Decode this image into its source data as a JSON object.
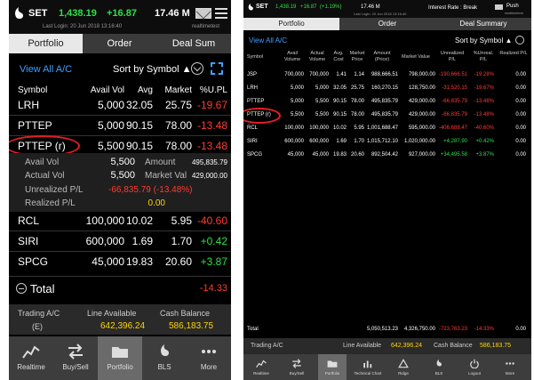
{
  "left": {
    "header": {
      "index": "SET",
      "price": "1,438.19",
      "change": "+16.87",
      "time": "17.46 M",
      "login": "Last Login: 20 Jun 2018 13:16:40",
      "user": "realtimetest"
    },
    "tabs": [
      "Portfolio",
      "Order",
      "Deal Sum"
    ],
    "view_all": "View All A/C",
    "sort": "Sort by Symbol ▲",
    "columns": [
      "Symbol",
      "Avail Vol",
      "Avg",
      "Market",
      "%U.PL"
    ],
    "rows": [
      {
        "symbol": "LRH",
        "vol": "5,000",
        "avg": "32.05",
        "market": "25.75",
        "upl": "-19.67",
        "sign": "neg"
      },
      {
        "symbol": "PTTEP",
        "vol": "5,000",
        "avg": "90.15",
        "market": "78.00",
        "upl": "-13.48",
        "sign": "neg"
      },
      {
        "symbol": "PTTEP (r)",
        "vol": "5,500",
        "avg": "90.15",
        "market": "78.00",
        "upl": "-13.48",
        "sign": "neg"
      }
    ],
    "detail": {
      "avail_vol_label": "Avail Vol",
      "avail_vol": "5,500",
      "amount_label": "Amount",
      "amount": "495,835.79",
      "actual_vol_label": "Actual Vol",
      "actual_vol": "5,500",
      "market_val_label": "Market Val",
      "market_val": "429,000.00",
      "unrealized_label": "Unrealized P/L",
      "unrealized": "-66,835.79 (-13.48%)",
      "realized_label": "Realized P/L",
      "realized": "0.00"
    },
    "rows2": [
      {
        "symbol": "RCL",
        "vol": "100,000",
        "avg": "10.02",
        "market": "5.95",
        "upl": "-40.60",
        "sign": "neg"
      },
      {
        "symbol": "SIRI",
        "vol": "600,000",
        "avg": "1.69",
        "market": "1.70",
        "upl": "+0.42",
        "sign": "pos"
      },
      {
        "symbol": "SPCG",
        "vol": "45,000",
        "avg": "19.83",
        "market": "20.60",
        "upl": "+3.87",
        "sign": "pos"
      }
    ],
    "total_label": "Total",
    "total_value": "-14.33",
    "footer": {
      "trading_label": "Trading A/C",
      "trading_value": "(E)",
      "line_label": "Line Available",
      "line_value": "642,396.24",
      "cash_label": "Cash Balance",
      "cash_value": "586,183.75"
    },
    "nav": [
      "Realtime",
      "Buy/Sell",
      "Portfolio",
      "BLS",
      "More"
    ]
  },
  "right": {
    "header": {
      "index": "SET",
      "price": "1,438.19",
      "change": "+16.87",
      "pct": "(+1.19%)",
      "time": "17.46 M",
      "login": "Last Login: 20 Jun 2018 13:16:40",
      "interest": "Interest Rate : Break",
      "push": "Push",
      "user": "realtimetest"
    },
    "tabs": [
      "Portfolio",
      "Order",
      "Deal Summary"
    ],
    "view_all": "View All A/C",
    "sort": "Sort by Symbol ▲",
    "columns": [
      "Symbol",
      "Avail Volume",
      "Actual Volume",
      "Avg. Cost",
      "Market Price",
      "Amount (Price)",
      "Market Value",
      "Unrealized P/L",
      "%Unreal. P/L",
      "Realized P/L"
    ],
    "rows": [
      {
        "symbol": "JSP",
        "avail": "700,000",
        "actual": "700,000",
        "avg": "1.41",
        "mkt": "1.14",
        "amount": "988,666.51",
        "mval": "798,000.00",
        "upl": "-190,666.51",
        "pct": "-19.28%",
        "real": "0.00",
        "sign": "neg"
      },
      {
        "symbol": "LRH",
        "avail": "5,000",
        "actual": "5,000",
        "avg": "32.05",
        "mkt": "25.75",
        "amount": "160,270.15",
        "mval": "128,750.00",
        "upl": "-31,520.15",
        "pct": "-19.67%",
        "real": "0.00",
        "sign": "neg"
      },
      {
        "symbol": "PTTEP",
        "avail": "5,000",
        "actual": "5,500",
        "avg": "90.15",
        "mkt": "78.00",
        "amount": "495,835.79",
        "mval": "429,000.00",
        "upl": "-66,835.79",
        "pct": "-13.48%",
        "real": "0.00",
        "sign": "neg"
      },
      {
        "symbol": "PTTEP (r)",
        "avail": "5,500",
        "actual": "5,500",
        "avg": "90.15",
        "mkt": "78.00",
        "amount": "495,835.79",
        "mval": "429,000.00",
        "upl": "-66,835.79",
        "pct": "-13.48%",
        "real": "0.00",
        "sign": "neg"
      },
      {
        "symbol": "RCL",
        "avail": "100,000",
        "actual": "100,000",
        "avg": "10.02",
        "mkt": "5.95",
        "amount": "1,001,688.47",
        "mval": "595,000.00",
        "upl": "-406,688.47",
        "pct": "-40.60%",
        "real": "0.00",
        "sign": "neg"
      },
      {
        "symbol": "SIRI",
        "avail": "600,000",
        "actual": "600,000",
        "avg": "1.69",
        "mkt": "1.70",
        "amount": "1,015,712.10",
        "mval": "1,020,000.00",
        "upl": "+4,287.90",
        "pct": "+0.42%",
        "real": "0.00",
        "sign": "pos"
      },
      {
        "symbol": "SPCG",
        "avail": "45,000",
        "actual": "45,000",
        "avg": "19.83",
        "mkt": "20.60",
        "amount": "892,504.42",
        "mval": "927,000.00",
        "upl": "+34,495.58",
        "pct": "+3.87%",
        "real": "0.00",
        "sign": "pos"
      }
    ],
    "total": {
      "label": "Total",
      "amount": "5,050,513.23",
      "mval": "4,326,750.00",
      "upl": "-723,763.23",
      "pct": "-14.33%",
      "real": "0.00"
    },
    "footer": {
      "trading_label": "Trading A/C",
      "line_label": "Line Available",
      "line_value": "642,396.24",
      "cash_label": "Cash Balance",
      "cash_value": "586,183.75"
    },
    "nav": [
      "Realtime",
      "Buy/Sell",
      "Portfolio",
      "Technical Chart",
      "Ridge",
      "BLS",
      "Logout",
      "More"
    ]
  }
}
